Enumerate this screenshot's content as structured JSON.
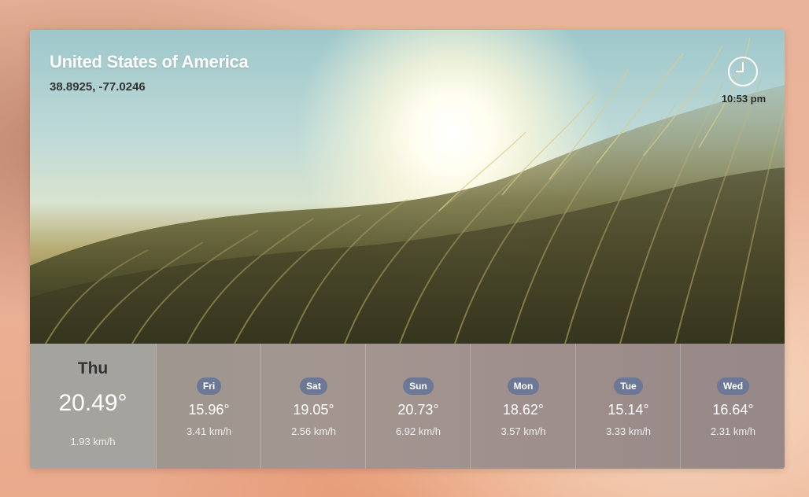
{
  "location": {
    "name": "United States of America",
    "coordinates": "38.8925, -77.0246",
    "time": "10:53 pm",
    "clock_icon": "clock-icon"
  },
  "today": {
    "day": "Thu",
    "temp": "20.49°",
    "wind": "1.93 km/h"
  },
  "forecast": [
    {
      "day": "Fri",
      "temp": "15.96°",
      "wind": "3.41 km/h"
    },
    {
      "day": "Sat",
      "temp": "19.05°",
      "wind": "2.56 km/h"
    },
    {
      "day": "Sun",
      "temp": "20.73°",
      "wind": "6.92 km/h"
    },
    {
      "day": "Mon",
      "temp": "18.62°",
      "wind": "3.57 km/h"
    },
    {
      "day": "Tue",
      "temp": "15.14°",
      "wind": "3.33 km/h"
    },
    {
      "day": "Wed",
      "temp": "16.64°",
      "wind": "2.31 km/h"
    }
  ],
  "colors": {
    "badge": "#6d7896",
    "today_bg": "#a4a39e",
    "forecast_bg": "#9e8e8c"
  }
}
